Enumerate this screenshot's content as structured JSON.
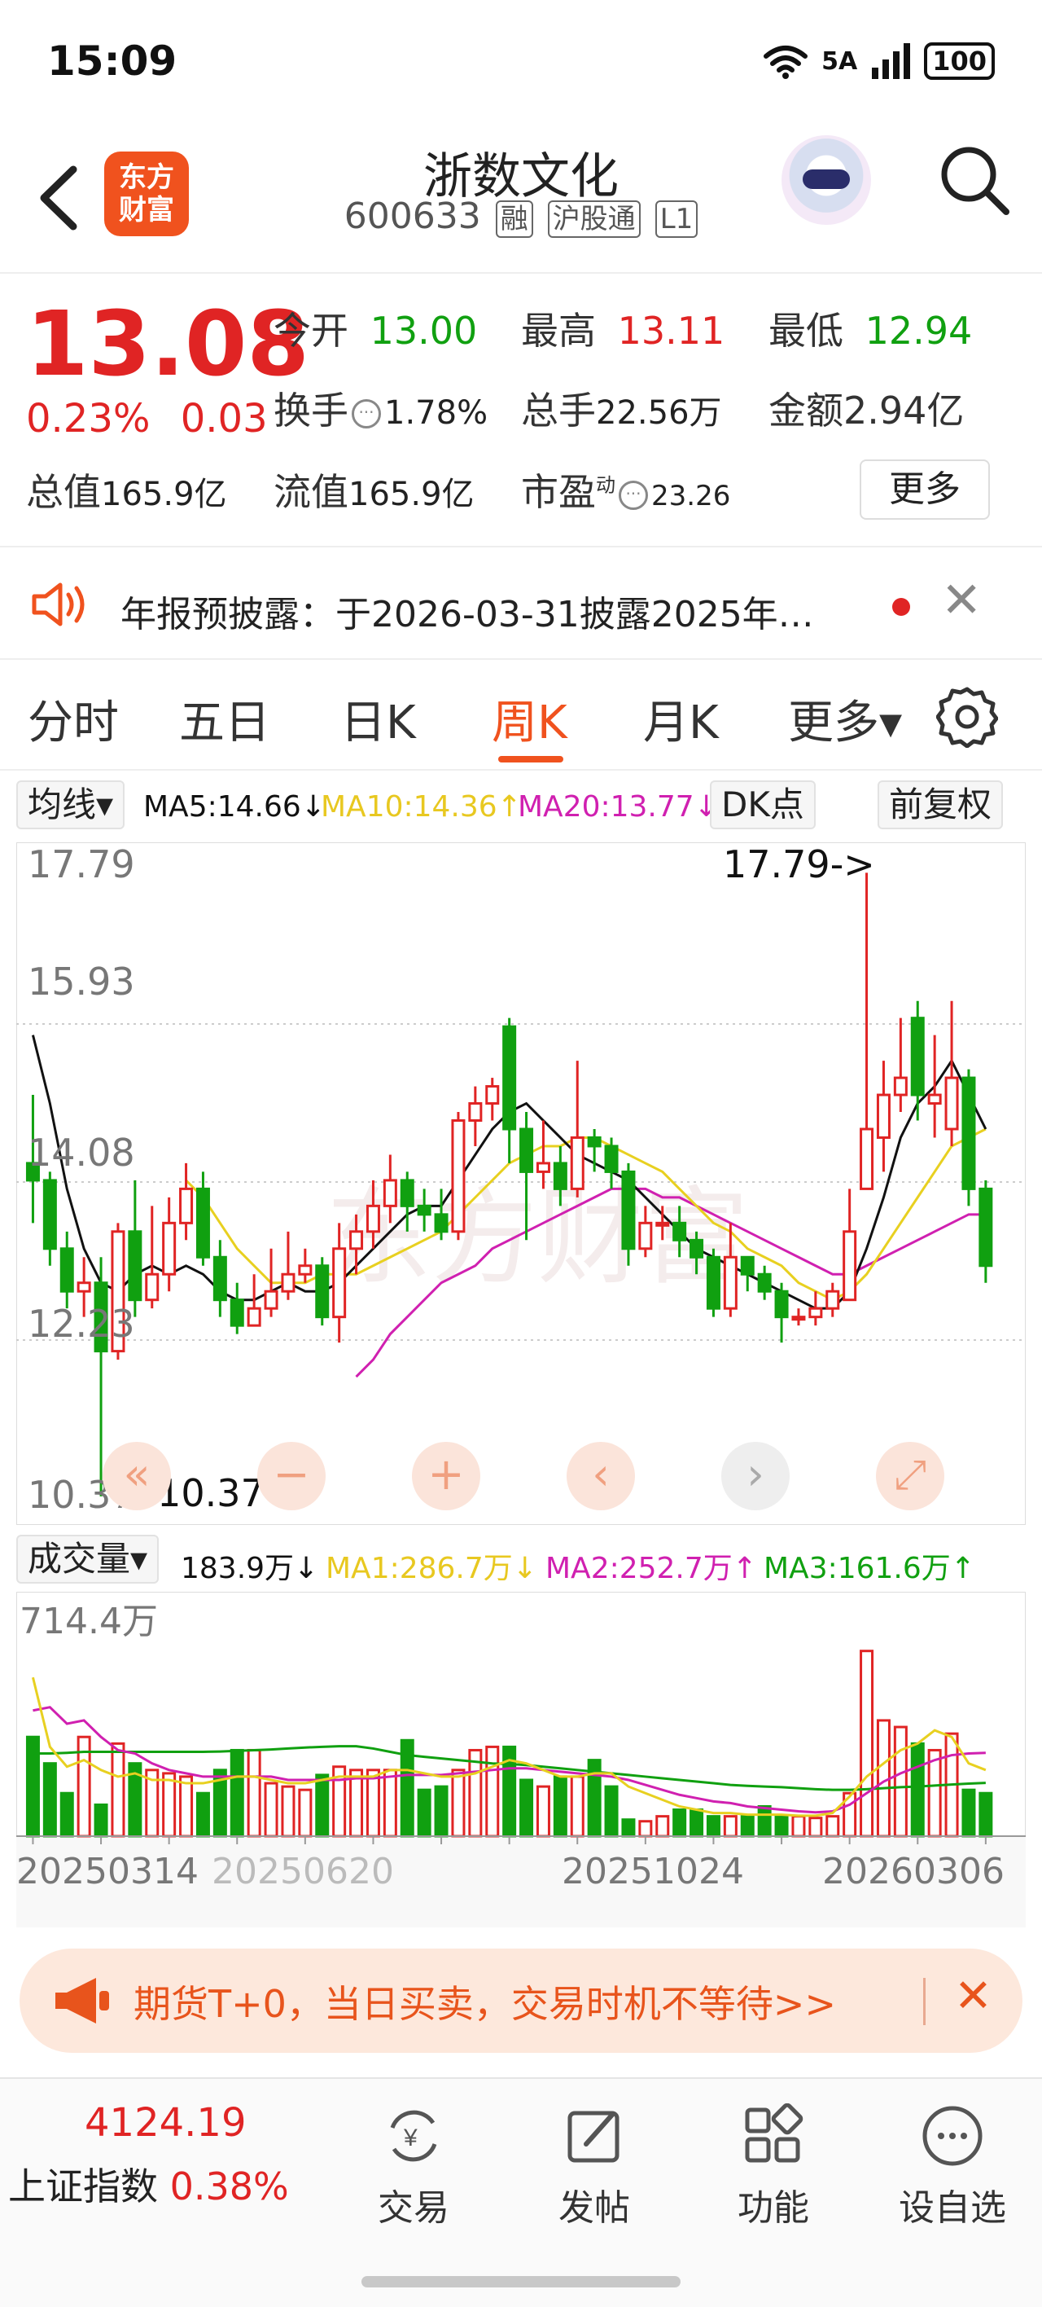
{
  "status_bar": {
    "time": "15:09",
    "network": "5A",
    "battery": "100"
  },
  "header": {
    "back_icon": "chevron-left-icon",
    "logo_text_line1": "东方",
    "logo_text_line2": "财富",
    "stock_name": "浙数文化",
    "stock_code": "600633",
    "tags": [
      "融",
      "沪股通",
      "L1"
    ],
    "search_icon": "search-icon"
  },
  "quote": {
    "price": "13.08",
    "change_pct": "0.23%",
    "change_abs": "0.03",
    "open_label": "今开",
    "open": "13.00",
    "high_label": "最高",
    "high": "13.11",
    "low_label": "最低",
    "low": "12.94",
    "turnover_label": "换手",
    "turnover": "1.78%",
    "volume_label": "总手",
    "volume": "22.56万",
    "amount_label": "金额",
    "amount": "2.94亿",
    "mktcap_label": "总值",
    "mktcap": "165.9亿",
    "float_label": "流值",
    "float_cap": "165.9亿",
    "pe_label": "市盈",
    "pe_sup": "动",
    "pe": "23.26",
    "more_button": "更多"
  },
  "notice": {
    "text": "年报预披露：于2026-03-31披露2025年…"
  },
  "tabs": [
    {
      "label": "分时"
    },
    {
      "label": "五日"
    },
    {
      "label": "日K"
    },
    {
      "label": "周K",
      "active": true
    },
    {
      "label": "月K"
    },
    {
      "label": "更多▾"
    }
  ],
  "ma_row": {
    "selector": "均线▾",
    "ma5": "MA5:14.66↓",
    "ma10": "MA10:14.36↑",
    "ma20": "MA20:13.77↓",
    "dk_button": "DK点",
    "adjust_button": "前复权"
  },
  "vol_row": {
    "selector": "成交量▾",
    "vol": "183.9万↓",
    "ma1": "MA1:286.7万↓",
    "ma2": "MA2:252.7万↑",
    "ma3": "MA3:161.6万↑"
  },
  "colors": {
    "up": "#e02424",
    "down": "#10a010",
    "ma5": "#111111",
    "ma10": "#e8d020",
    "ma20": "#d020b0",
    "accent": "#f0521e"
  },
  "chart_data": [
    {
      "type": "candlestick",
      "y_ticks": [
        "17.79",
        "15.93",
        "14.08",
        "12.23",
        "10.37"
      ],
      "ylim": [
        10.37,
        17.79
      ],
      "annotations": {
        "max": "17.79->",
        "min": "<-10.37"
      },
      "candles": [
        [
          14.3,
          14.1,
          15.1,
          13.6
        ],
        [
          14.1,
          13.3,
          14.2,
          13.1
        ],
        [
          13.3,
          12.8,
          13.5,
          12.6
        ],
        [
          12.8,
          12.9,
          13.2,
          12.5
        ],
        [
          12.9,
          12.1,
          13.2,
          10.4
        ],
        [
          12.1,
          13.5,
          13.6,
          12.0
        ],
        [
          13.5,
          12.7,
          14.1,
          12.5
        ],
        [
          12.7,
          13.0,
          13.8,
          12.6
        ],
        [
          13.0,
          13.6,
          13.9,
          12.8
        ],
        [
          13.6,
          14.0,
          14.3,
          13.4
        ],
        [
          14.0,
          13.2,
          14.2,
          13.1
        ],
        [
          13.2,
          12.7,
          13.4,
          12.5
        ],
        [
          12.7,
          12.4,
          12.9,
          12.3
        ],
        [
          12.4,
          12.6,
          13.0,
          12.4
        ],
        [
          12.6,
          12.8,
          13.3,
          12.5
        ],
        [
          12.8,
          13.0,
          13.5,
          12.7
        ],
        [
          13.0,
          13.1,
          13.3,
          12.9
        ],
        [
          13.1,
          12.5,
          13.2,
          12.4
        ],
        [
          12.5,
          13.3,
          13.6,
          12.2
        ],
        [
          13.3,
          13.5,
          13.7,
          13.0
        ],
        [
          13.5,
          13.8,
          14.1,
          13.3
        ],
        [
          13.8,
          14.1,
          14.4,
          13.6
        ],
        [
          14.1,
          13.8,
          14.2,
          13.5
        ],
        [
          13.8,
          13.7,
          14.0,
          13.5
        ],
        [
          13.7,
          13.5,
          14.0,
          13.4
        ],
        [
          13.5,
          14.8,
          14.9,
          13.4
        ],
        [
          14.8,
          15.0,
          15.2,
          14.5
        ],
        [
          15.0,
          15.2,
          15.3,
          14.8
        ],
        [
          15.9,
          14.7,
          16.0,
          14.3
        ],
        [
          14.7,
          14.2,
          14.9,
          13.4
        ],
        [
          14.2,
          14.3,
          14.8,
          14.0
        ],
        [
          14.3,
          14.0,
          14.5,
          13.8
        ],
        [
          14.0,
          14.6,
          15.5,
          13.9
        ],
        [
          14.6,
          14.5,
          14.7,
          14.2
        ],
        [
          14.5,
          14.2,
          14.6,
          14.0
        ],
        [
          14.2,
          13.3,
          14.3,
          13.1
        ],
        [
          13.3,
          13.6,
          13.8,
          13.2
        ],
        [
          13.6,
          13.6,
          13.8,
          13.4
        ],
        [
          13.6,
          13.4,
          13.8,
          13.2
        ],
        [
          13.4,
          13.2,
          13.5,
          13.0
        ],
        [
          13.2,
          12.6,
          13.3,
          12.5
        ],
        [
          12.6,
          13.2,
          13.6,
          12.5
        ],
        [
          13.2,
          13.0,
          13.2,
          12.8
        ],
        [
          13.0,
          12.8,
          13.1,
          12.7
        ],
        [
          12.8,
          12.5,
          12.9,
          12.2
        ],
        [
          12.5,
          12.5,
          12.6,
          12.4
        ],
        [
          12.5,
          12.6,
          12.8,
          12.4
        ],
        [
          12.6,
          12.8,
          12.9,
          12.5
        ],
        [
          12.7,
          13.5,
          14.0,
          12.7
        ],
        [
          14.0,
          14.7,
          17.7,
          14.0
        ],
        [
          14.6,
          15.1,
          15.5,
          14.2
        ],
        [
          15.1,
          15.3,
          16.0,
          14.9
        ],
        [
          16.0,
          15.1,
          16.2,
          14.8
        ],
        [
          15.0,
          15.1,
          15.8,
          14.6
        ],
        [
          14.7,
          15.3,
          16.2,
          14.5
        ],
        [
          15.3,
          14.0,
          15.4,
          13.8
        ],
        [
          14.0,
          13.1,
          14.1,
          12.9
        ]
      ],
      "ma5": [
        15.8,
        15.0,
        14.0,
        13.3,
        12.9,
        12.8,
        13.0,
        13.1,
        13.0,
        13.1,
        13.0,
        12.8,
        12.7,
        12.7,
        12.8,
        12.9,
        12.8,
        12.8,
        12.9,
        13.1,
        13.3,
        13.5,
        13.7,
        13.8,
        13.8,
        14.1,
        14.4,
        14.7,
        14.9,
        15.0,
        14.8,
        14.6,
        14.4,
        14.3,
        14.2,
        14.1,
        13.9,
        13.7,
        13.5,
        13.3,
        13.2,
        13.1,
        13.0,
        12.9,
        12.8,
        12.7,
        12.6,
        12.6,
        12.8,
        13.3,
        13.9,
        14.6,
        15.0,
        15.2,
        15.5,
        15.1,
        14.7
      ],
      "ma10": [
        null,
        null,
        null,
        null,
        null,
        null,
        null,
        null,
        null,
        14.1,
        13.9,
        13.6,
        13.3,
        13.1,
        12.9,
        12.9,
        12.9,
        13.0,
        13.0,
        13.0,
        13.1,
        13.2,
        13.3,
        13.4,
        13.5,
        13.7,
        13.9,
        14.1,
        14.3,
        14.4,
        14.5,
        14.5,
        14.6,
        14.6,
        14.5,
        14.4,
        14.3,
        14.2,
        14.0,
        13.8,
        13.6,
        13.5,
        13.3,
        13.2,
        13.1,
        12.9,
        12.8,
        12.7,
        12.8,
        13.0,
        13.3,
        13.6,
        13.9,
        14.2,
        14.5,
        14.6,
        14.7
      ],
      "ma20": [
        null,
        null,
        null,
        null,
        null,
        null,
        null,
        null,
        null,
        null,
        null,
        null,
        null,
        null,
        null,
        null,
        null,
        null,
        null,
        11.8,
        12.0,
        12.3,
        12.5,
        12.7,
        12.9,
        13.0,
        13.1,
        13.3,
        13.4,
        13.5,
        13.6,
        13.7,
        13.8,
        13.9,
        14.0,
        14.0,
        14.0,
        13.9,
        13.9,
        13.8,
        13.7,
        13.6,
        13.5,
        13.4,
        13.3,
        13.2,
        13.1,
        13.0,
        13.0,
        13.1,
        13.2,
        13.3,
        13.4,
        13.5,
        13.6,
        13.7,
        13.7
      ]
    },
    {
      "type": "bar",
      "y_ticks": [
        "714.4万"
      ],
      "x_tick_labels": [
        "20250314",
        "20250620",
        "20251024",
        "20260306"
      ],
      "ylim": [
        0,
        714.4
      ],
      "volumes": [
        300,
        220,
        130,
        300,
        95,
        280,
        220,
        200,
        190,
        180,
        130,
        200,
        260,
        260,
        160,
        150,
        140,
        185,
        210,
        200,
        200,
        200,
        290,
        140,
        150,
        200,
        260,
        270,
        270,
        170,
        150,
        180,
        180,
        230,
        150,
        50,
        45,
        60,
        80,
        80,
        60,
        60,
        60,
        90,
        60,
        60,
        55,
        60,
        130,
        560,
        350,
        330,
        280,
        260,
        310,
        140,
        130
      ],
      "vol_ma1": [
        480,
        270,
        210,
        230,
        200,
        180,
        190,
        170,
        170,
        160,
        160,
        170,
        180,
        180,
        170,
        160,
        160,
        170,
        180,
        180,
        180,
        200,
        200,
        190,
        180,
        180,
        190,
        210,
        230,
        220,
        200,
        180,
        180,
        190,
        190,
        150,
        130,
        110,
        90,
        80,
        70,
        70,
        65,
        65,
        65,
        62,
        62,
        70,
        120,
        180,
        220,
        260,
        280,
        320,
        300,
        220,
        200
      ],
      "vol_ma2": [
        380,
        390,
        340,
        350,
        300,
        260,
        250,
        220,
        200,
        190,
        180,
        180,
        180,
        180,
        180,
        170,
        170,
        170,
        170,
        175,
        175,
        180,
        185,
        185,
        185,
        190,
        195,
        200,
        205,
        205,
        200,
        195,
        190,
        185,
        180,
        170,
        155,
        140,
        125,
        115,
        105,
        100,
        90,
        85,
        80,
        75,
        72,
        75,
        95,
        130,
        165,
        190,
        210,
        230,
        245,
        250,
        252
      ],
      "vol_ma3": [
        250,
        250,
        252,
        255,
        255,
        255,
        255,
        255,
        255,
        255,
        255,
        256,
        258,
        260,
        262,
        265,
        268,
        270,
        272,
        272,
        265,
        255,
        245,
        240,
        235,
        230,
        225,
        220,
        218,
        215,
        210,
        205,
        200,
        195,
        190,
        185,
        180,
        175,
        170,
        165,
        160,
        155,
        152,
        150,
        148,
        145,
        142,
        140,
        140,
        142,
        145,
        148,
        150,
        153,
        156,
        159,
        161
      ]
    }
  ],
  "chart_controls": [
    "«",
    "−",
    "+",
    "‹",
    "›",
    "⤢"
  ],
  "ad_banner": {
    "text": "期货T+0，当日买卖，交易时机不等待>>",
    "icon": "megaphone-icon"
  },
  "bottom_bar": {
    "index_value": "4124.19",
    "index_name": "上证指数",
    "index_change": "0.38%",
    "nav": [
      {
        "label": "交易",
        "icon": "trade-icon"
      },
      {
        "label": "发帖",
        "icon": "edit-icon"
      },
      {
        "label": "功能",
        "icon": "grid-icon"
      },
      {
        "label": "设自选",
        "icon": "more-icon"
      }
    ]
  }
}
